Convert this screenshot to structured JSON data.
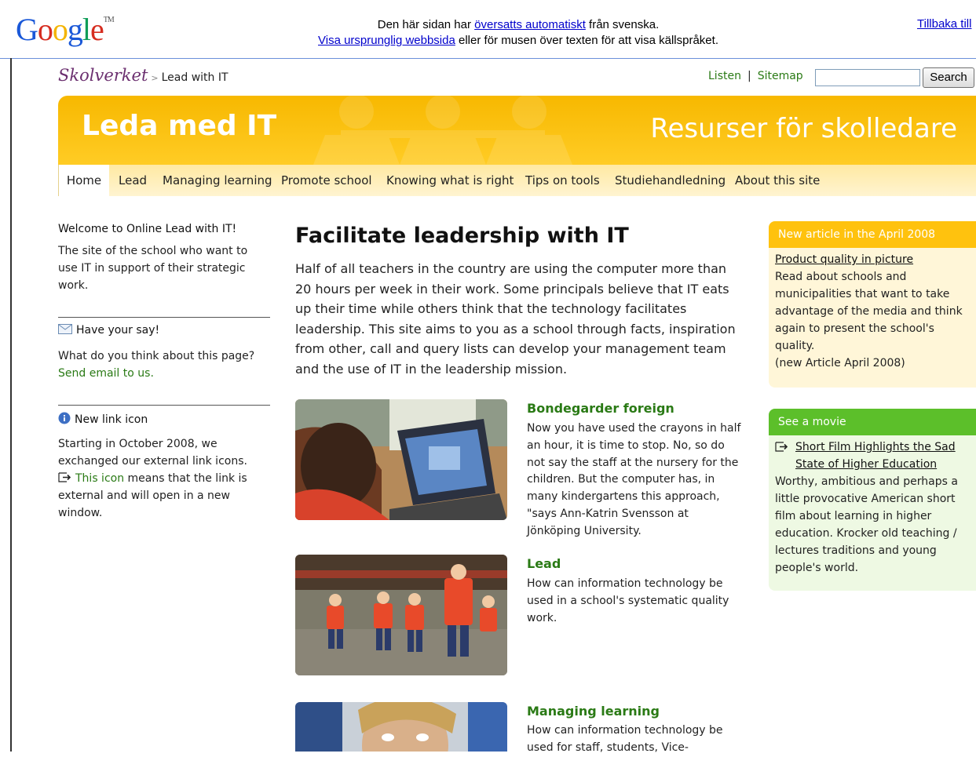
{
  "google_bar": {
    "logo": "Google",
    "tm": "TM",
    "line1_before": "Den här sidan har ",
    "line1_link": "översatts automatiskt",
    "line1_after": " från svenska.",
    "line2_link": "Visa ursprunglig webbsida",
    "line2_after": " eller för musen över texten för att visa källspråket.",
    "back_link": "Tillbaka till"
  },
  "header": {
    "brand": "Skolverket",
    "crumb_sep": ">",
    "crumb_current": "Lead with IT",
    "listen": "Listen",
    "sitemap": "Sitemap",
    "search_button": "Search",
    "search_value": ""
  },
  "banner": {
    "title": "Leda med IT",
    "tagline": "Resurser för skolledare"
  },
  "nav": [
    "Home",
    "Lead",
    "Managing learning",
    "Promote school",
    "Knowing what is right",
    "Tips on tools",
    "Studiehandledning",
    "About this site"
  ],
  "left": {
    "welcome_title": "Welcome to Online Lead with IT!",
    "welcome_text": "The site of the school who want to use IT in support of their strategic work.",
    "say_title": "Have your say!",
    "say_text": "What do you think about this page?",
    "say_link": "Send email to us.",
    "newicon_title": "New link icon",
    "newicon_text1": "Starting in October 2008, we exchanged our external link icons.",
    "newicon_link": "This icon",
    "newicon_text2": " means that the link is external and will open in a new window."
  },
  "main": {
    "heading": "Facilitate leadership with IT",
    "intro": "Half of all teachers in the country are using the computer more than 20 hours per week in their work.  Some principals believe that IT eats up their time while others think that the technology facilitates leadership.  This site aims to you as a school through facts, inspiration from other, call and query lists can develop your management team and the use of IT in the leadership mission.",
    "articles": [
      {
        "title": "Bondegarder foreign",
        "text": "Now you have used the crayons in half an hour, it is time to stop.  No, so do not say the staff at the nursery for the children.  But the computer has, in many kindergartens this approach, \"says Ann-Katrin Svensson at Jönköping University."
      },
      {
        "title": "Lead",
        "text": "How can information technology be used in a school's systematic quality work."
      },
      {
        "title": "Managing learning",
        "text": "How can information technology be used for staff, students, Vice-"
      }
    ]
  },
  "right": {
    "box1_head": "New article in the April 2008",
    "box1_link": "Product quality in picture",
    "box1_text": "Read about schools and municipalities that want to take advantage of the media and think again to present the school's quality.",
    "box1_note": "(new Article April 2008)",
    "box2_head": "See a movie",
    "box2_link": "Short Film Highlights the Sad State of Higher Education",
    "box2_text": "Worthy, ambitious and perhaps a little provocative American short film about learning in higher education.  Krocker old teaching / lectures traditions and young people's world."
  },
  "colors": {
    "google_blue": "#4285f4",
    "banner_yellow": "#ffc20e",
    "link_green": "#2a7a15",
    "brand_purple": "#6b2f6f"
  }
}
